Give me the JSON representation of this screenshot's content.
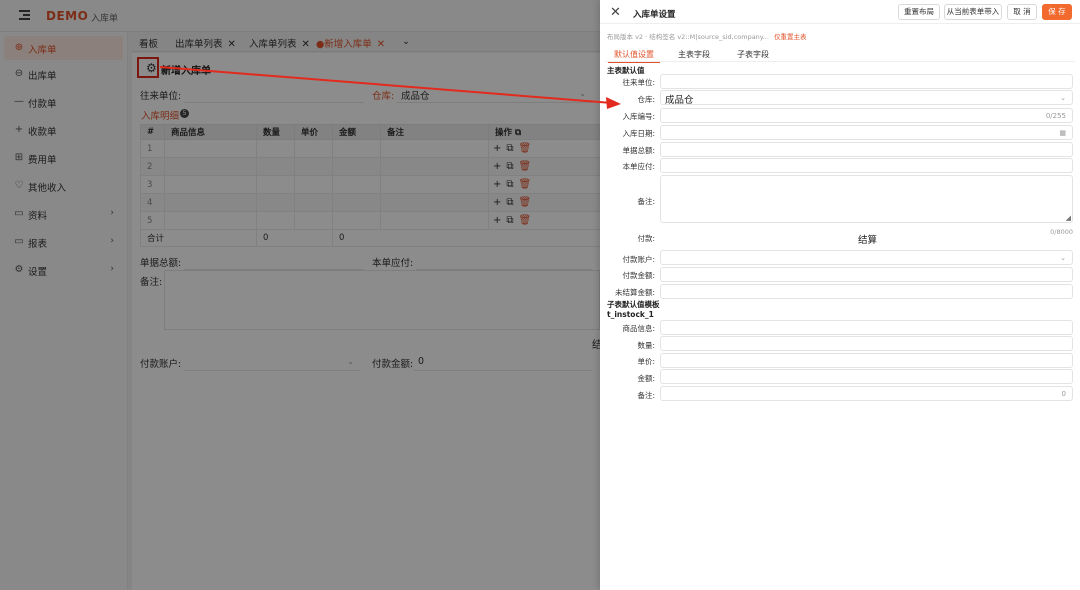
{
  "header": {
    "brand": "DEMO",
    "breadcrumb": "入库单"
  },
  "sidebar": {
    "items": [
      {
        "label": "入库单",
        "icon": "circle-plus-icon"
      },
      {
        "label": "出库单",
        "icon": "circle-minus-icon"
      },
      {
        "label": "付款单",
        "icon": "minus-icon"
      },
      {
        "label": "收款单",
        "icon": "plus-icon"
      },
      {
        "label": "费用单",
        "icon": "bill-icon"
      },
      {
        "label": "其他收入",
        "icon": "heart-icon"
      },
      {
        "label": "资料",
        "icon": "folder-icon"
      },
      {
        "label": "报表",
        "icon": "folder-icon"
      },
      {
        "label": "设置",
        "icon": "gear-icon"
      }
    ]
  },
  "tabs": [
    {
      "label": "看板"
    },
    {
      "label": "出库单列表"
    },
    {
      "label": "入库单列表"
    },
    {
      "label": "●新增入库单"
    }
  ],
  "page": {
    "title": "新增入库单",
    "supplier_label": "往来单位:",
    "warehouse_label": "仓库:",
    "warehouse_value": "成品仓",
    "section_label": "入库明细",
    "section_count": "5",
    "table": {
      "headers": [
        "#",
        "商品信息",
        "数量",
        "单价",
        "金额",
        "备注",
        "操作"
      ],
      "rows": [
        "1",
        "2",
        "3",
        "4",
        "5"
      ],
      "total_label": "合计",
      "total_qty": "0",
      "total_amount": "0"
    },
    "doc_total_label": "单据总额:",
    "payable_label": "本单应付:",
    "remark_label": "备注:",
    "cut_text": "结",
    "pay_account_label": "付款账户:",
    "pay_amount_label": "付款金额:",
    "pay_amount_value": "0"
  },
  "drawer": {
    "title": "入库单设置",
    "buttons": {
      "reset": "重置布局",
      "import": "从当前表单带入",
      "cancel": "取 消",
      "save": "保 存"
    },
    "meta": "布局版本 v2 · 结构签名 v2::M|source_sid,company...",
    "meta_link": "仅重置主表",
    "tabs": [
      "默认值设置",
      "主表字段",
      "子表字段"
    ],
    "main_section": "主表默认值",
    "fields": {
      "supplier": "往来单位:",
      "warehouse": "仓库:",
      "warehouse_value": "成品仓",
      "doc_no": "入库编号:",
      "doc_no_counter": "0/255",
      "date": "入库日期:",
      "doc_total": "单据总额:",
      "payable": "本单应付:",
      "remark": "备注:",
      "remark_counter": "0/8000",
      "pay": "付款:",
      "settle": "结算",
      "pay_account": "付款账户:",
      "pay_amount": "付款金额:",
      "unsettled": "未结算金额:"
    },
    "sub_section": "子表默认值模板",
    "sub_table_name": "t_instock_1",
    "sub_fields": {
      "product": "商品信息:",
      "qty": "数量:",
      "price": "单价:",
      "amount": "金额:",
      "remark": "备注:",
      "remark_counter": "0"
    }
  }
}
